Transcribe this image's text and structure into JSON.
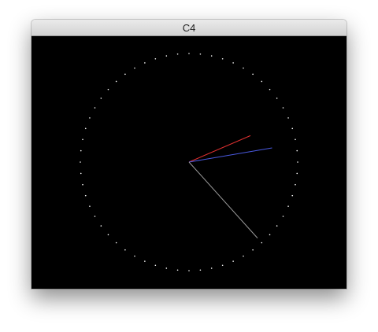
{
  "window": {
    "title": "C4"
  },
  "clock": {
    "background_color": "#000000",
    "dot_color": "#ffffff",
    "tick_count": 60,
    "time": {
      "hour": 2,
      "minute": 13,
      "second": 23
    },
    "hands": {
      "hour": {
        "color": "#e03030"
      },
      "minute": {
        "color": "#4a5ae0"
      },
      "second": {
        "color": "#9a9a9a"
      }
    }
  }
}
